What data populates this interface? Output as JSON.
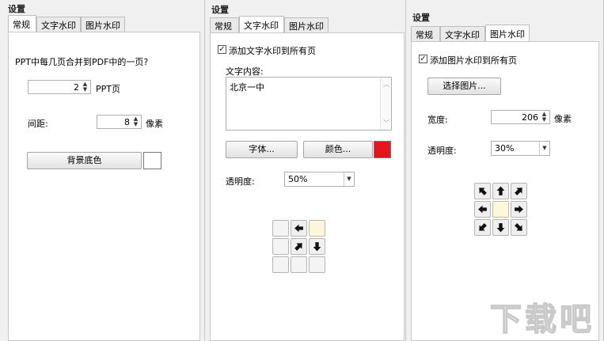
{
  "panel1": {
    "title": "设置",
    "tabs": [
      "常规",
      "文字水印",
      "图片水印"
    ],
    "active_tab": "常规",
    "question": "PPT中每几页合并到PDF中的一页?",
    "pages_value": "2",
    "pages_unit": "PPT页",
    "spacing_label": "间距:",
    "spacing_value": "8",
    "spacing_unit": "像素",
    "bg_button": "背景底色",
    "bg_color": "#ffffff"
  },
  "panel2": {
    "title": "设置",
    "tabs": [
      "常规",
      "文字水印",
      "图片水印"
    ],
    "active_tab": "文字水印",
    "checkbox_label": "添加文字水印到所有页",
    "checked": true,
    "content_label": "文字内容:",
    "content_value": "北京一中",
    "font_button": "字体...",
    "color_button": "颜色...",
    "color_value": "#e8141b",
    "opacity_label": "透明度:",
    "opacity_value": "50%",
    "position_selected": "top-right"
  },
  "panel3": {
    "title": "设置",
    "tabs": [
      "常规",
      "文字水印",
      "图片水印"
    ],
    "active_tab": "图片水印",
    "checkbox_label": "添加图片水印到所有页",
    "checked": true,
    "select_image_button": "选择图片...",
    "width_label": "宽度:",
    "width_value": "206",
    "width_unit": "像素",
    "opacity_label": "透明度:",
    "opacity_value": "30%",
    "position_selected": "center"
  },
  "watermark": {
    "text": "下载吧"
  }
}
